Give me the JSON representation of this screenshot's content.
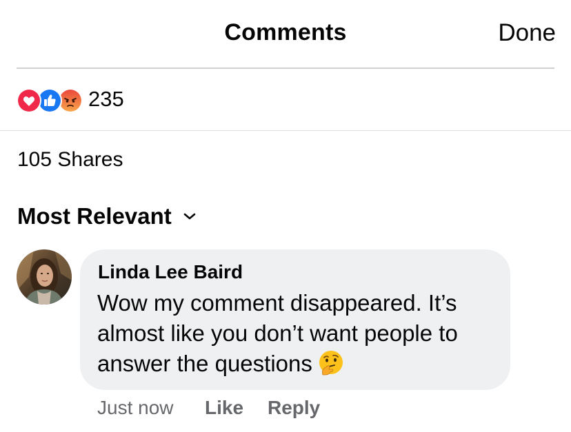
{
  "header": {
    "title": "Comments",
    "done_label": "Done"
  },
  "reactions": {
    "icons": [
      "love-icon",
      "like-icon",
      "angry-icon"
    ],
    "count": "235",
    "colors": {
      "love": "#f0284a",
      "like": "#1877f2",
      "angry": "#f7714c"
    }
  },
  "shares": {
    "label": "105 Shares"
  },
  "sort": {
    "label": "Most Relevant",
    "icon": "chevron-down-icon"
  },
  "comment": {
    "author": "Linda Lee Baird",
    "text": "Wow my comment disappeared. It’s almost like you don’t want people to answer the questions",
    "emoji": "thinking-face-icon",
    "bubble_color": "#eff0f2",
    "actions": {
      "time": "Just now",
      "like": "Like",
      "reply": "Reply"
    }
  }
}
